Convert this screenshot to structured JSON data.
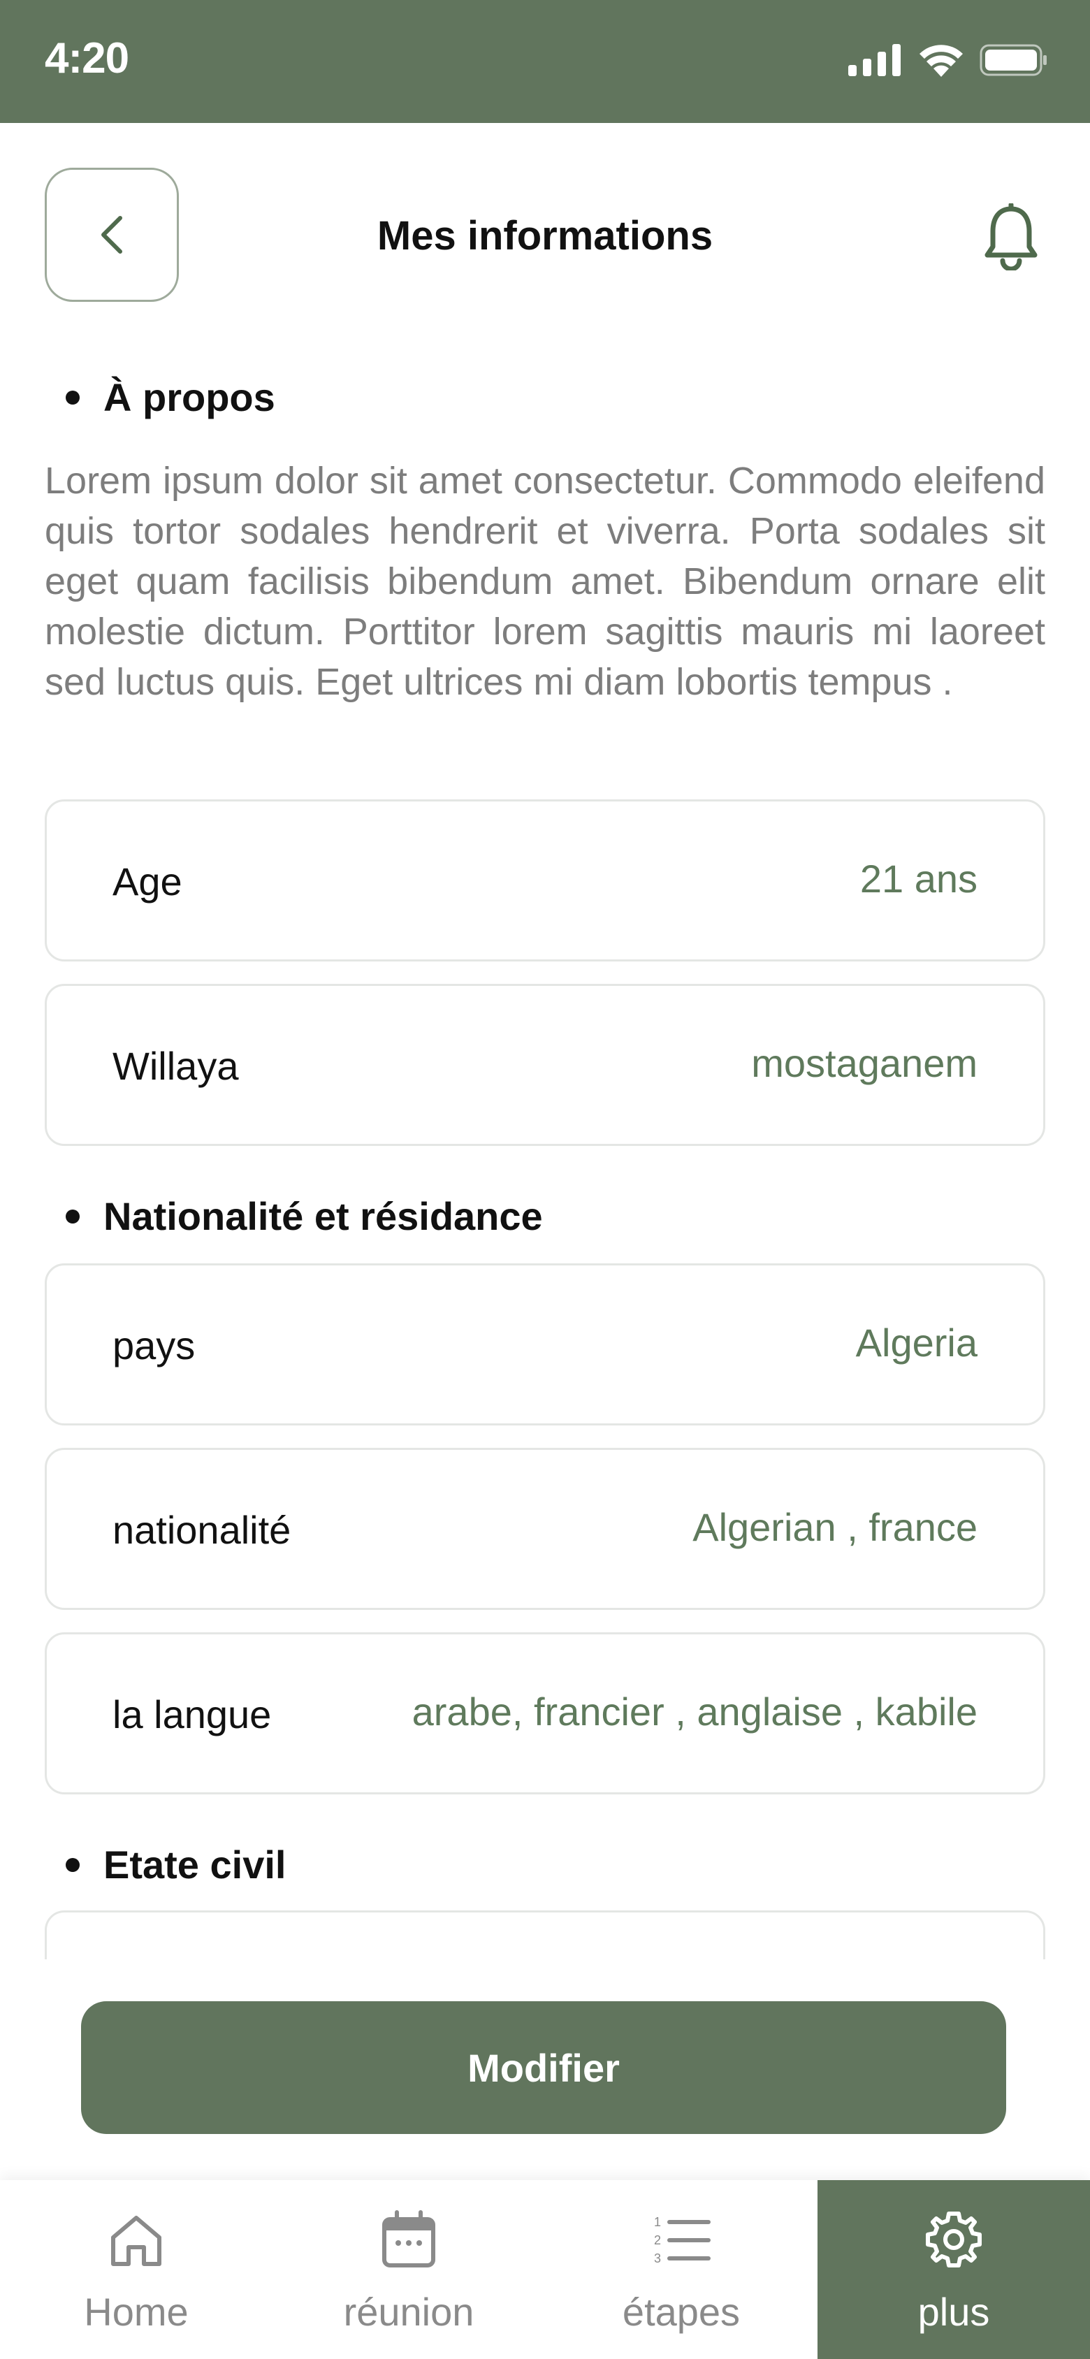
{
  "status_bar": {
    "time": "4:20"
  },
  "header": {
    "title": "Mes informations"
  },
  "sections": {
    "about": {
      "title": "À propos",
      "text": "Lorem ipsum dolor sit amet consectetur. Commodo eleifend quis tortor sodales hendrerit et viverra. Porta sodales sit eget quam facilisis bibendum amet. Bibendum ornare elit molestie dictum. Porttitor lorem sagittis mauris mi laoreet sed luctus quis. Eget ultrices mi diam lobortis tempus .",
      "fields": [
        {
          "label": "Age",
          "value": "21 ans"
        },
        {
          "label": "Willaya",
          "value": "mostaganem"
        }
      ]
    },
    "nationality": {
      "title": "Nationalité et résidance",
      "fields": [
        {
          "label": "pays",
          "value": "Algeria"
        },
        {
          "label": "nationalité",
          "value": "Algerian , france"
        },
        {
          "label": "la langue",
          "value": "arabe, francier , anglaise , kabile"
        }
      ]
    },
    "civil": {
      "title": "Etate civil"
    }
  },
  "actions": {
    "modify_label": "Modifier"
  },
  "nav": {
    "items": [
      {
        "label": "Home",
        "icon": "home-icon"
      },
      {
        "label": "réunion",
        "icon": "calendar-icon"
      },
      {
        "label": "étapes",
        "icon": "numbered-list-icon"
      },
      {
        "label": "plus",
        "icon": "gear-icon"
      }
    ],
    "active_index": 3
  },
  "colors": {
    "accent": "#61755d",
    "value_text": "#5f7a5c",
    "body_text": "#7d7d7d"
  }
}
